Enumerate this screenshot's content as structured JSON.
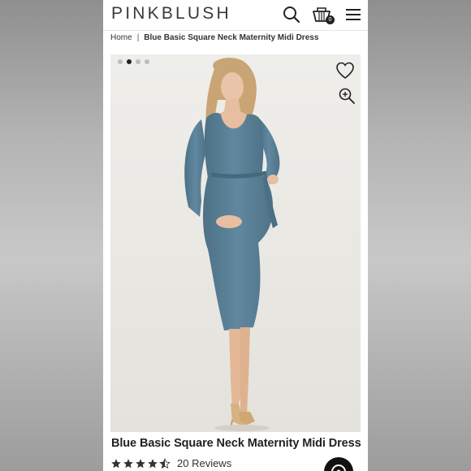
{
  "brand": {
    "logo_text": "PINKBLUSH"
  },
  "header": {
    "icons": [
      "search-icon",
      "cart-icon",
      "menu-icon"
    ],
    "cart_count": "0"
  },
  "breadcrumb": {
    "home": "Home",
    "separator": "|",
    "current": "Blue Basic Square Neck Maternity Midi Dress"
  },
  "gallery": {
    "image_count": 4,
    "active_index": 1,
    "icons": [
      "heart-icon",
      "zoom-in-icon"
    ]
  },
  "product": {
    "title": "Blue Basic Square Neck Maternity Midi Dress",
    "rating": 4.5,
    "rating_max": 5,
    "reviews_label": "20 Reviews"
  },
  "colors": {
    "dress": "#5b7f93",
    "background": "#ecebe7",
    "text": "#222222"
  }
}
